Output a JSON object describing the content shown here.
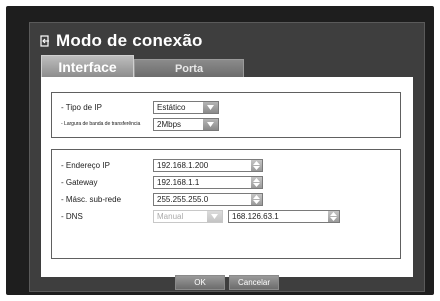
{
  "window": {
    "title": "Modo de conexão"
  },
  "tabs": [
    {
      "label": "Interface",
      "active": true
    },
    {
      "label": "Porta",
      "active": false
    }
  ],
  "group1": {
    "ip_type": {
      "label": "- Tipo de IP",
      "value": "Estático"
    },
    "bandwidth": {
      "label": "- Largura de banda de transferência",
      "value": "2Mbps"
    }
  },
  "group2": {
    "ip_address": {
      "label": "- Endereço IP",
      "value": "192.168.1.200"
    },
    "gateway": {
      "label": "- Gateway",
      "value": "192.168.1.1"
    },
    "subnet": {
      "label": "- Másc. sub-rede",
      "value": "255.255.255.0"
    },
    "dns": {
      "label": "- DNS",
      "mode": "Manual",
      "value": "168.126.63.1"
    }
  },
  "buttons": {
    "ok": "OK",
    "cancel": "Cancelar"
  },
  "colors": {
    "background": "#1e1e1e",
    "dialog": "#3e3e3e",
    "panel": "#ffffff"
  },
  "icons": {
    "title": "exit-icon",
    "combo": "chevron-down-icon",
    "spin": "spin-arrows-icon"
  }
}
